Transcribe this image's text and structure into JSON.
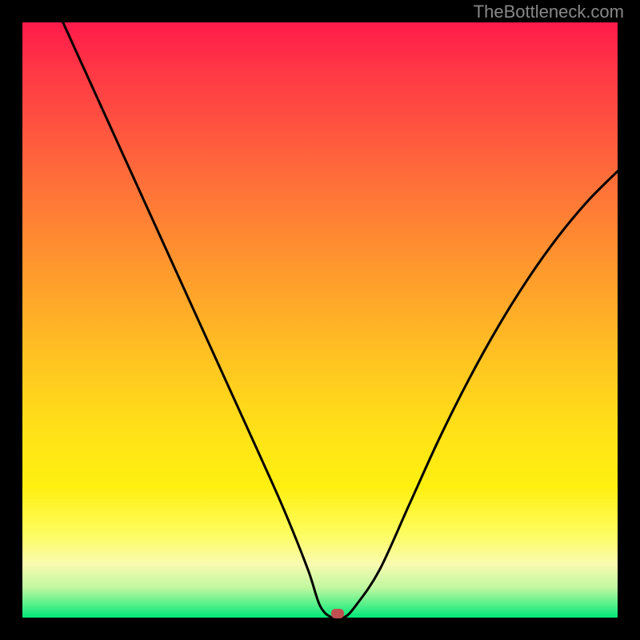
{
  "watermark": "TheBottleneck.com",
  "chart_data": {
    "type": "line",
    "title": "",
    "xlabel": "",
    "ylabel": "",
    "xlim": [
      0,
      100
    ],
    "ylim": [
      0,
      100
    ],
    "plot_size": 744,
    "series": [
      {
        "name": "curve",
        "x": [
          0,
          5,
          10,
          15,
          20,
          25,
          30,
          35,
          40,
          44,
          48,
          50,
          52,
          54,
          56,
          60,
          65,
          70,
          75,
          80,
          85,
          90,
          95,
          100
        ],
        "values": [
          115,
          104,
          93,
          82,
          71,
          60,
          49,
          38,
          27,
          18,
          8,
          2,
          0,
          0,
          2,
          8,
          19,
          30,
          40,
          49,
          57,
          64,
          70,
          75
        ]
      }
    ],
    "vertex": {
      "x": 53,
      "y": 0.7
    },
    "gradient_stops": [
      {
        "pct": 0,
        "color": "#ff1a4a"
      },
      {
        "pct": 50,
        "color": "#ffab28"
      },
      {
        "pct": 78,
        "color": "#fff010"
      },
      {
        "pct": 100,
        "color": "#00e878"
      }
    ]
  }
}
